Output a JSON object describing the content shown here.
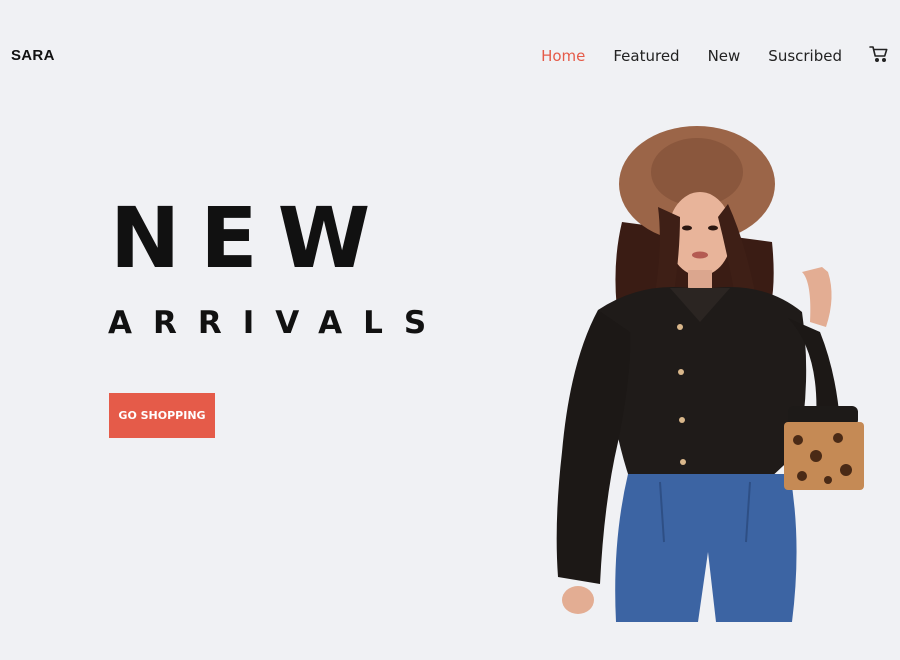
{
  "header": {
    "brand": "SARA",
    "nav": [
      {
        "label": "Home",
        "active": true
      },
      {
        "label": "Featured",
        "active": false
      },
      {
        "label": "New",
        "active": false
      },
      {
        "label": "Suscribed",
        "active": false
      }
    ],
    "cart_icon": "cart-icon"
  },
  "hero": {
    "title": "NEW",
    "subtitle": "ARRIVALS",
    "cta_label": "GO SHOPPING"
  },
  "colors": {
    "accent": "#e55b49",
    "background": "#f0f1f4",
    "text": "#111111"
  }
}
